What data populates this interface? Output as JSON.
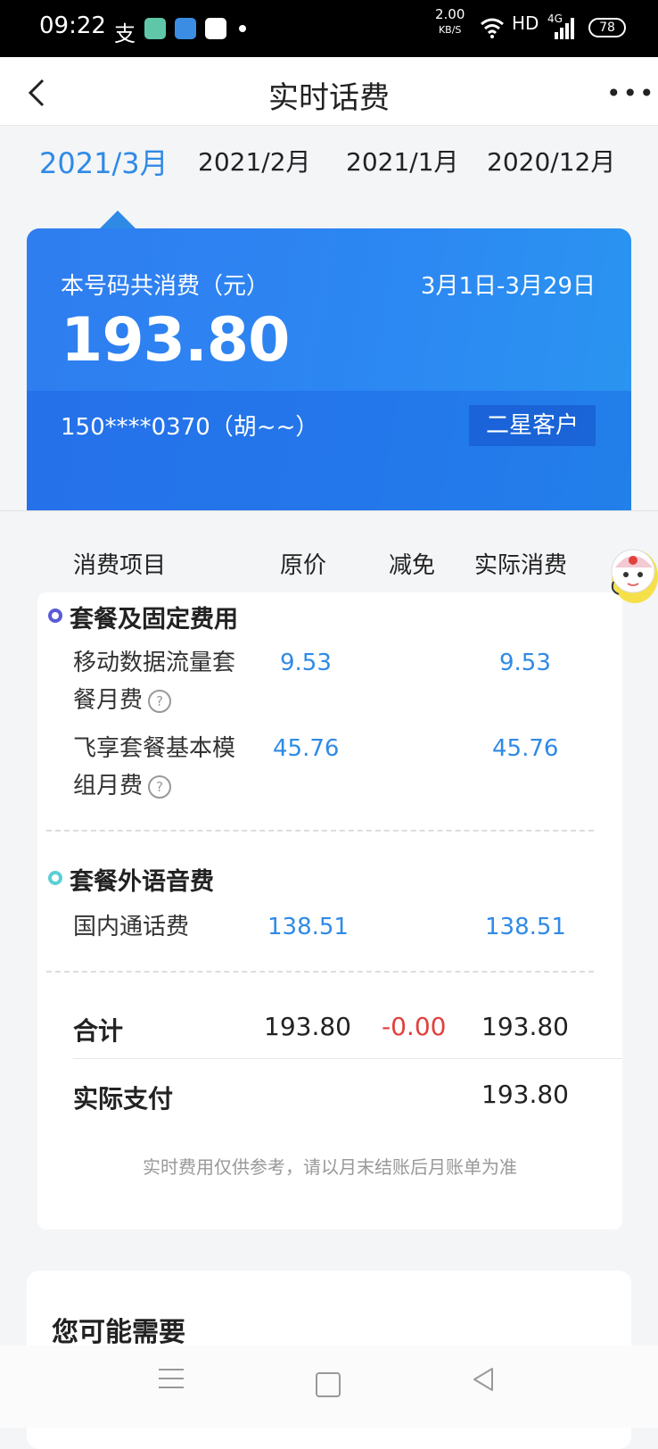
{
  "status_bar": {
    "time": "09:22",
    "speed": "2.00",
    "speed_unit": "KB/S",
    "hd": "HD",
    "network": "4G",
    "battery": "78"
  },
  "header": {
    "title": "实时话费"
  },
  "month_tabs": [
    {
      "label": "2021/3月",
      "active": true
    },
    {
      "label": "2021/2月",
      "active": false
    },
    {
      "label": "2021/1月",
      "active": false
    },
    {
      "label": "2020/12月",
      "active": false
    }
  ],
  "summary": {
    "label": "本号码共消费（元）",
    "period": "3月1日-3月29日",
    "amount": "193.80",
    "phone": "150****0370（胡~~）",
    "level": "二星客户"
  },
  "columns": {
    "item": "消费项目",
    "original": "原价",
    "discount": "减免",
    "actual": "实际消费"
  },
  "sections": [
    {
      "title": "套餐及固定费用",
      "dot_color": "#5b5bd6",
      "items": [
        {
          "name_line1": "移动数据流量套",
          "name_line2": "餐月费",
          "original": "9.53",
          "actual": "9.53"
        },
        {
          "name_line1": "飞享套餐基本模",
          "name_line2": "组月费",
          "original": "45.76",
          "actual": "45.76"
        }
      ]
    },
    {
      "title": "套餐外语音费",
      "dot_color": "#5ccfd6",
      "items": [
        {
          "name_line1": "国内通话费",
          "original": "138.51",
          "actual": "138.51"
        }
      ]
    }
  ],
  "totals": {
    "label": "合计",
    "original": "193.80",
    "discount": "-0.00",
    "actual": "193.80"
  },
  "payment": {
    "label": "实际支付",
    "amount": "193.80"
  },
  "note": "实时费用仅供参考，请以月末结账后月账单为准",
  "you_may_need": "您可能需要",
  "colors": {
    "accent_blue": "#2f8ae6",
    "discount_red": "#e0413c"
  }
}
